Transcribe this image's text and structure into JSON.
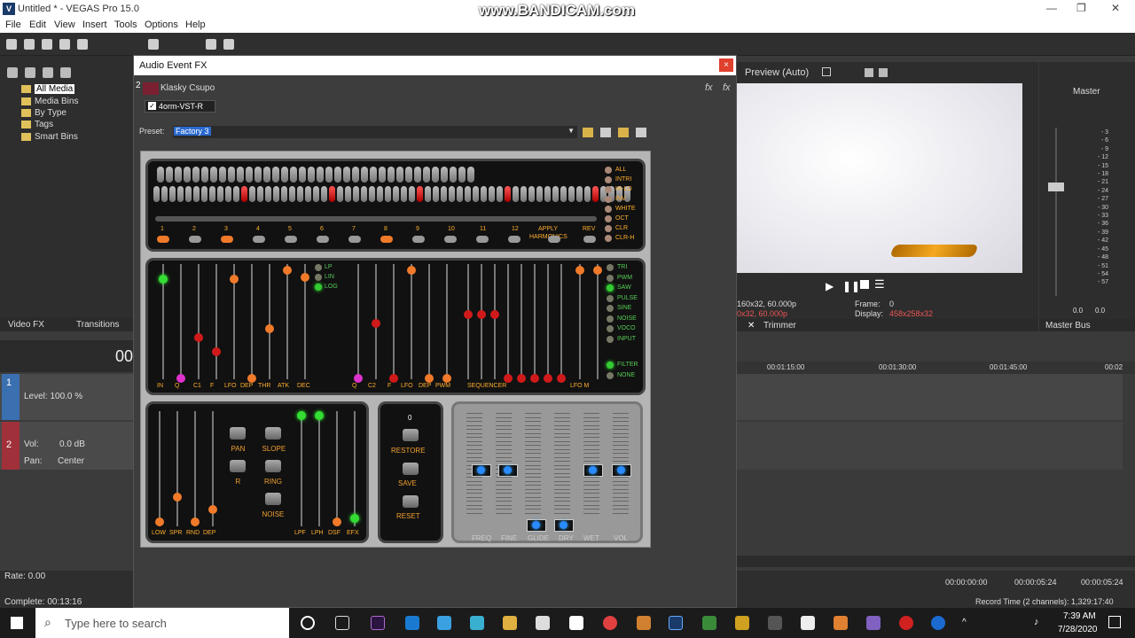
{
  "window": {
    "title": "Untitled * - VEGAS Pro 15.0",
    "watermark": "www.BANDICAM.com"
  },
  "menu": [
    "File",
    "Edit",
    "View",
    "Insert",
    "Tools",
    "Options",
    "Help"
  ],
  "explorer": {
    "items": [
      "All Media",
      "Media Bins",
      "By Type",
      "Tags",
      "Smart Bins"
    ]
  },
  "left_tabs": {
    "video_fx": "Video FX",
    "transitions": "Transitions"
  },
  "track1": {
    "number": "1",
    "level": "Level: 100.0 %"
  },
  "track2": {
    "number": "2",
    "vol_label": "Vol:",
    "vol_value": "0.0 dB",
    "pan_label": "Pan:",
    "pan_value": "Center"
  },
  "status": {
    "rate": "Rate: 0.00",
    "complete": "Complete: 00:13:16",
    "left_counter": "00"
  },
  "dialog": {
    "title": "Audio Event FX",
    "close": "×",
    "chain_number": "2",
    "event_name": "Klasky Csupo",
    "plugin_name": "4orm-VST-R",
    "preset_label": "Preset:",
    "preset_value": "Factory 3"
  },
  "plugin": {
    "top_numbers": [
      "1",
      "2",
      "3",
      "4",
      "5",
      "6",
      "7",
      "8",
      "9",
      "10",
      "11",
      "12"
    ],
    "apply_label": "APPLY",
    "harmonics_label": "HARMONICS",
    "rev_label": "REV",
    "right_options": [
      "ALL",
      "INTRI",
      "HI-LO",
      "INV",
      "WHITE",
      "OCT",
      "CLR",
      "CLR-H"
    ],
    "filter_modes": [
      "LP",
      "LIN",
      "LOG"
    ],
    "waveforms": [
      "TRI",
      "PWM",
      "SAW",
      "PULSE",
      "SINE",
      "NOISE",
      "VOCO",
      "INPUT"
    ],
    "filter_opts": [
      "FILTER",
      "NONE"
    ],
    "mid_labels": [
      "IN",
      "Q",
      "C1",
      "F",
      "LFO",
      "DEP",
      "THR",
      "ATK",
      "DEC",
      "Q",
      "C2",
      "F",
      "LFO",
      "DEP",
      "PWM"
    ],
    "sequencer_label": "SEQUENCER",
    "lfo_m_label": "LFO  M",
    "bottom_left_labels": [
      "LOW",
      "SPR",
      "RND",
      "DEP"
    ],
    "bottom_right_labels": [
      "LPF",
      "LPH",
      "DSF",
      "EFX"
    ],
    "buttons": [
      "PAN",
      "SLOPE",
      "R",
      "RING",
      "NOISE"
    ],
    "center_value": "0",
    "center_buttons": [
      "RESTORE",
      "SAVE",
      "RESET"
    ],
    "mixer_labels": [
      "FREQ",
      "FINE",
      "GLIDE",
      "DRY",
      "WET",
      "VOL"
    ]
  },
  "preview": {
    "label": "Preview (Auto)",
    "project": "160x32, 60.000p",
    "preview_res": "0x32, 60.000p",
    "frame_label": "Frame:",
    "frame_value": "0",
    "display_label": "Display:",
    "display_value": "458x258x32",
    "tab": "Trimmer"
  },
  "master": {
    "label": "Master",
    "scale": [
      "3",
      "6",
      "9",
      "12",
      "15",
      "18",
      "21",
      "24",
      "27",
      "30",
      "33",
      "36",
      "39",
      "42",
      "45",
      "48",
      "51",
      "54",
      "57"
    ],
    "left_val": "0.0",
    "right_val": "0.0",
    "bus_label": "Master Bus"
  },
  "timeline": {
    "ruler": [
      "00:01:15:00",
      "00:01:30:00",
      "00:01:45:00",
      "00:02"
    ],
    "time1": "00:00:00:00",
    "time2": "00:00:05:24",
    "time3": "00:00:05:24",
    "record": "Record Time (2 channels): 1,329:17:40"
  },
  "taskbar": {
    "search": "Type here to search",
    "time": "7:39 AM",
    "date": "7/28/2020"
  }
}
